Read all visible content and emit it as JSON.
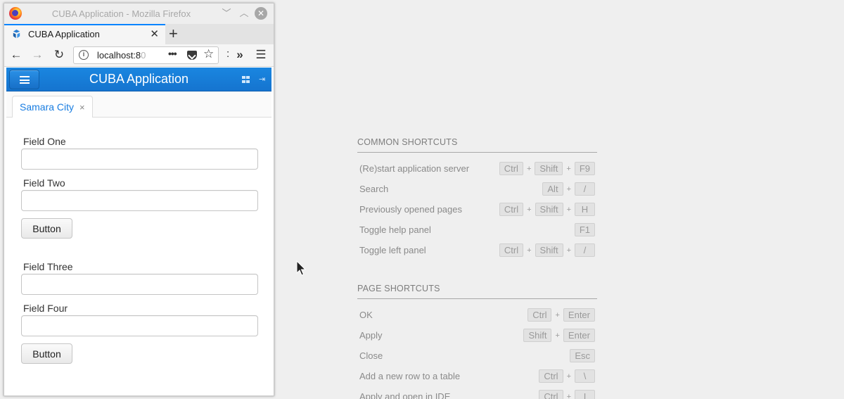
{
  "window": {
    "title": "CUBA Application - Mozilla Firefox",
    "min_icon": "chevron-down-icon",
    "max_icon": "chevron-up-icon",
    "close_icon": "close-icon",
    "close_glyph": "✕",
    "min_glyph": "﹀",
    "max_glyph": "︿"
  },
  "browser": {
    "tab_title": "CUBA Application",
    "tab_close": "✕",
    "new_tab": "+",
    "url_visible": "localhost:8",
    "url_faded": "0",
    "more": "•••",
    "star": "☆",
    "overflow_dots": ":",
    "overflow": "»",
    "menu": "☰",
    "back": "←",
    "forward": "→",
    "reload": "↻",
    "info": "i"
  },
  "app": {
    "title": "CUBA Application",
    "logout_glyph": "⇥",
    "tab": {
      "label": "Samara City",
      "close": "×"
    },
    "fields": [
      {
        "caption": "Field One",
        "value": ""
      },
      {
        "caption": "Field Two",
        "value": ""
      },
      {
        "caption": "Field Three",
        "value": ""
      },
      {
        "caption": "Field Four",
        "value": ""
      }
    ],
    "buttons": [
      "Button",
      "Button"
    ]
  },
  "shortcuts": {
    "common": {
      "title": "COMMON SHORTCUTS",
      "rows": [
        {
          "label": "(Re)start application server",
          "keys": [
            "Ctrl",
            "Shift",
            "F9"
          ]
        },
        {
          "label": "Search",
          "keys": [
            "Alt",
            "/"
          ]
        },
        {
          "label": "Previously opened pages",
          "keys": [
            "Ctrl",
            "Shift",
            "H"
          ]
        },
        {
          "label": "Toggle help panel",
          "keys": [
            "F1"
          ]
        },
        {
          "label": "Toggle left panel",
          "keys": [
            "Ctrl",
            "Shift",
            "/"
          ]
        }
      ]
    },
    "page": {
      "title": "PAGE SHORTCUTS",
      "rows": [
        {
          "label": "OK",
          "keys": [
            "Ctrl",
            "Enter"
          ]
        },
        {
          "label": "Apply",
          "keys": [
            "Shift",
            "Enter"
          ]
        },
        {
          "label": "Close",
          "keys": [
            "Esc"
          ]
        },
        {
          "label": "Add a new row to a table",
          "keys": [
            "Ctrl",
            "\\"
          ]
        },
        {
          "label": "Apply and open in IDE",
          "keys": [
            "Ctrl",
            "I"
          ]
        }
      ]
    },
    "plus": "+"
  },
  "colors": {
    "accent": "#197de1",
    "header": "#1574cf",
    "firefox_tab_accent": "#0a84ff"
  }
}
